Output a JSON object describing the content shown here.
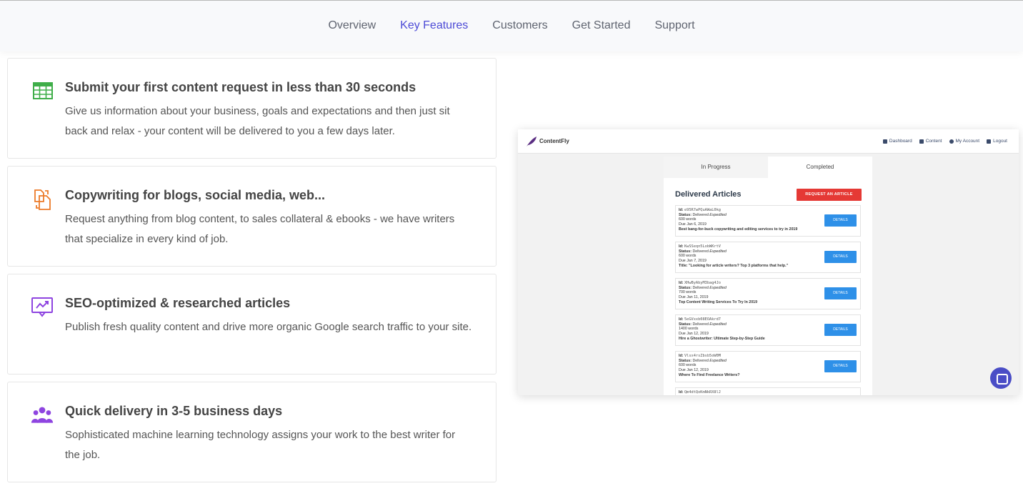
{
  "nav": {
    "items": [
      {
        "label": "Overview"
      },
      {
        "label": "Key Features",
        "active": true
      },
      {
        "label": "Customers"
      },
      {
        "label": "Get Started"
      },
      {
        "label": "Support"
      }
    ]
  },
  "features": [
    {
      "icon": "grid-table-icon",
      "title": "Submit your first content request in less than 30 seconds",
      "desc": "Give us information about your business, goals and expectations and then just sit back and relax - your content will be delivered to you a few days later."
    },
    {
      "icon": "documents-transfer-icon",
      "title": "Copywriting for blogs, social media, web...",
      "desc": "Request anything from blog content, to sales collateral & ebooks - we have writers that specialize in every kind of job."
    },
    {
      "icon": "chart-presentation-icon",
      "title": "SEO-optimized & researched articles",
      "desc": "Publish fresh quality content and drive more organic Google search traffic to your site."
    },
    {
      "icon": "users-group-icon",
      "title": "Quick delivery in 3-5 business days",
      "desc": "Sophisticated machine learning technology assigns your work to the best writer for the job."
    }
  ],
  "screenshot": {
    "brand": "ContentFly",
    "menu": [
      "Dashboard",
      "Content",
      "My Account",
      "Logout"
    ],
    "tabs": [
      "In Progress",
      "Completed"
    ],
    "heading": "Delivered Articles",
    "request_button": "REQUEST AN ARTICLE",
    "details_label": "DETAILS",
    "id_label": "Id:",
    "status_label": "Status:",
    "articles": [
      {
        "id": "e95R7wPQuAWaL0kg",
        "status": "Delivered",
        "speed": "Expedited",
        "words": "600 words",
        "due": "Due Jan 6, 2019",
        "title": "Best bang-for-buck copywriting and editing services to try in 2019"
      },
      {
        "id": "KwSSeqn5LobWKrtV",
        "status": "Delivered",
        "speed": "Expedited",
        "words": "600 words",
        "due": "Due Jan 7, 2019",
        "title": "Title: \"Looking for article writers? Top 3 platforms that help.\""
      },
      {
        "id": "XHwByAbyM3bag4Jo",
        "status": "Delivered",
        "speed": "Expedited",
        "words": "700 words",
        "due": "Due Jan 11, 2019",
        "title": "Top Content Writing Services To Try In 2019"
      },
      {
        "id": "5eGVxxb08EOAkrd7",
        "status": "Delivered",
        "speed": "Expedited",
        "words": "1400 words",
        "due": "Due Jan 12, 2019",
        "title": "Hire a Ghostwriter: Ultimate Step-by-Step Guide"
      },
      {
        "id": "Vlsx4rsZbsb5oW0M",
        "status": "Delivered",
        "speed": "Expedited",
        "words": "600 words",
        "due": "Due Jan 12, 2019",
        "title": "Where To Find Freelance Writers?"
      }
    ],
    "partial_id": "Qm4dtQoKmNkRX8lJ"
  },
  "colors": {
    "accent": "#4c4ad6",
    "request": "#e53935",
    "details": "#2e90e8"
  }
}
